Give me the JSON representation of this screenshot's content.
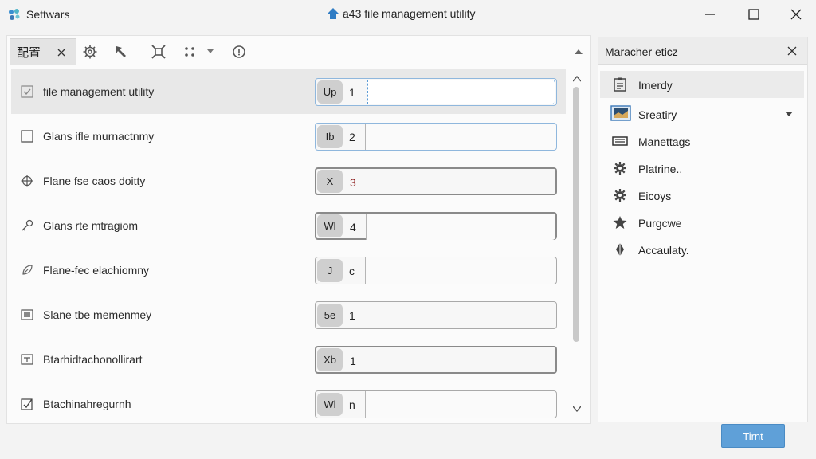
{
  "app": {
    "name": "Settwars",
    "window_title": "a43 file management utility"
  },
  "tab": {
    "label": "配置"
  },
  "rows": [
    {
      "label": "file management utility",
      "badge": "Up",
      "value": "1",
      "selected": true
    },
    {
      "label": "Glans ifle murnactnmy",
      "badge": "Ib",
      "value": "2"
    },
    {
      "label": "Flane fse caos doitty",
      "badge": "X",
      "value": "3"
    },
    {
      "label": "Glans rte mtragiom",
      "badge": "Wl",
      "value": "4"
    },
    {
      "label": "Flane-fec elachiomny",
      "badge": "J",
      "value": "c"
    },
    {
      "label": "Slane tbe memenmey",
      "badge": "5e",
      "value": "1"
    },
    {
      "label": "Btarhidtachonollirart",
      "badge": "Xb",
      "value": "1"
    },
    {
      "label": "Btachinahregurnh",
      "badge": "Wl",
      "value": "n"
    }
  ],
  "right_panel": {
    "title": "Maracher eticz",
    "items": [
      {
        "label": "Imerdy",
        "icon": "clipboard-icon"
      },
      {
        "label": "Sreatiry",
        "icon": "monitor-icon"
      },
      {
        "label": "Manettags",
        "icon": "keyboard-icon"
      },
      {
        "label": "Platrine..",
        "icon": "gear-icon"
      },
      {
        "label": "Eicoys",
        "icon": "gear-icon"
      },
      {
        "label": "Purgcwe",
        "icon": "star-icon"
      },
      {
        "label": "Accaulaty.",
        "icon": "diamond-icon"
      }
    ]
  },
  "primary_button": {
    "label": "Tirnt"
  },
  "colors": {
    "accent": "#5fa0d8",
    "focus": "#5b9bd5"
  }
}
